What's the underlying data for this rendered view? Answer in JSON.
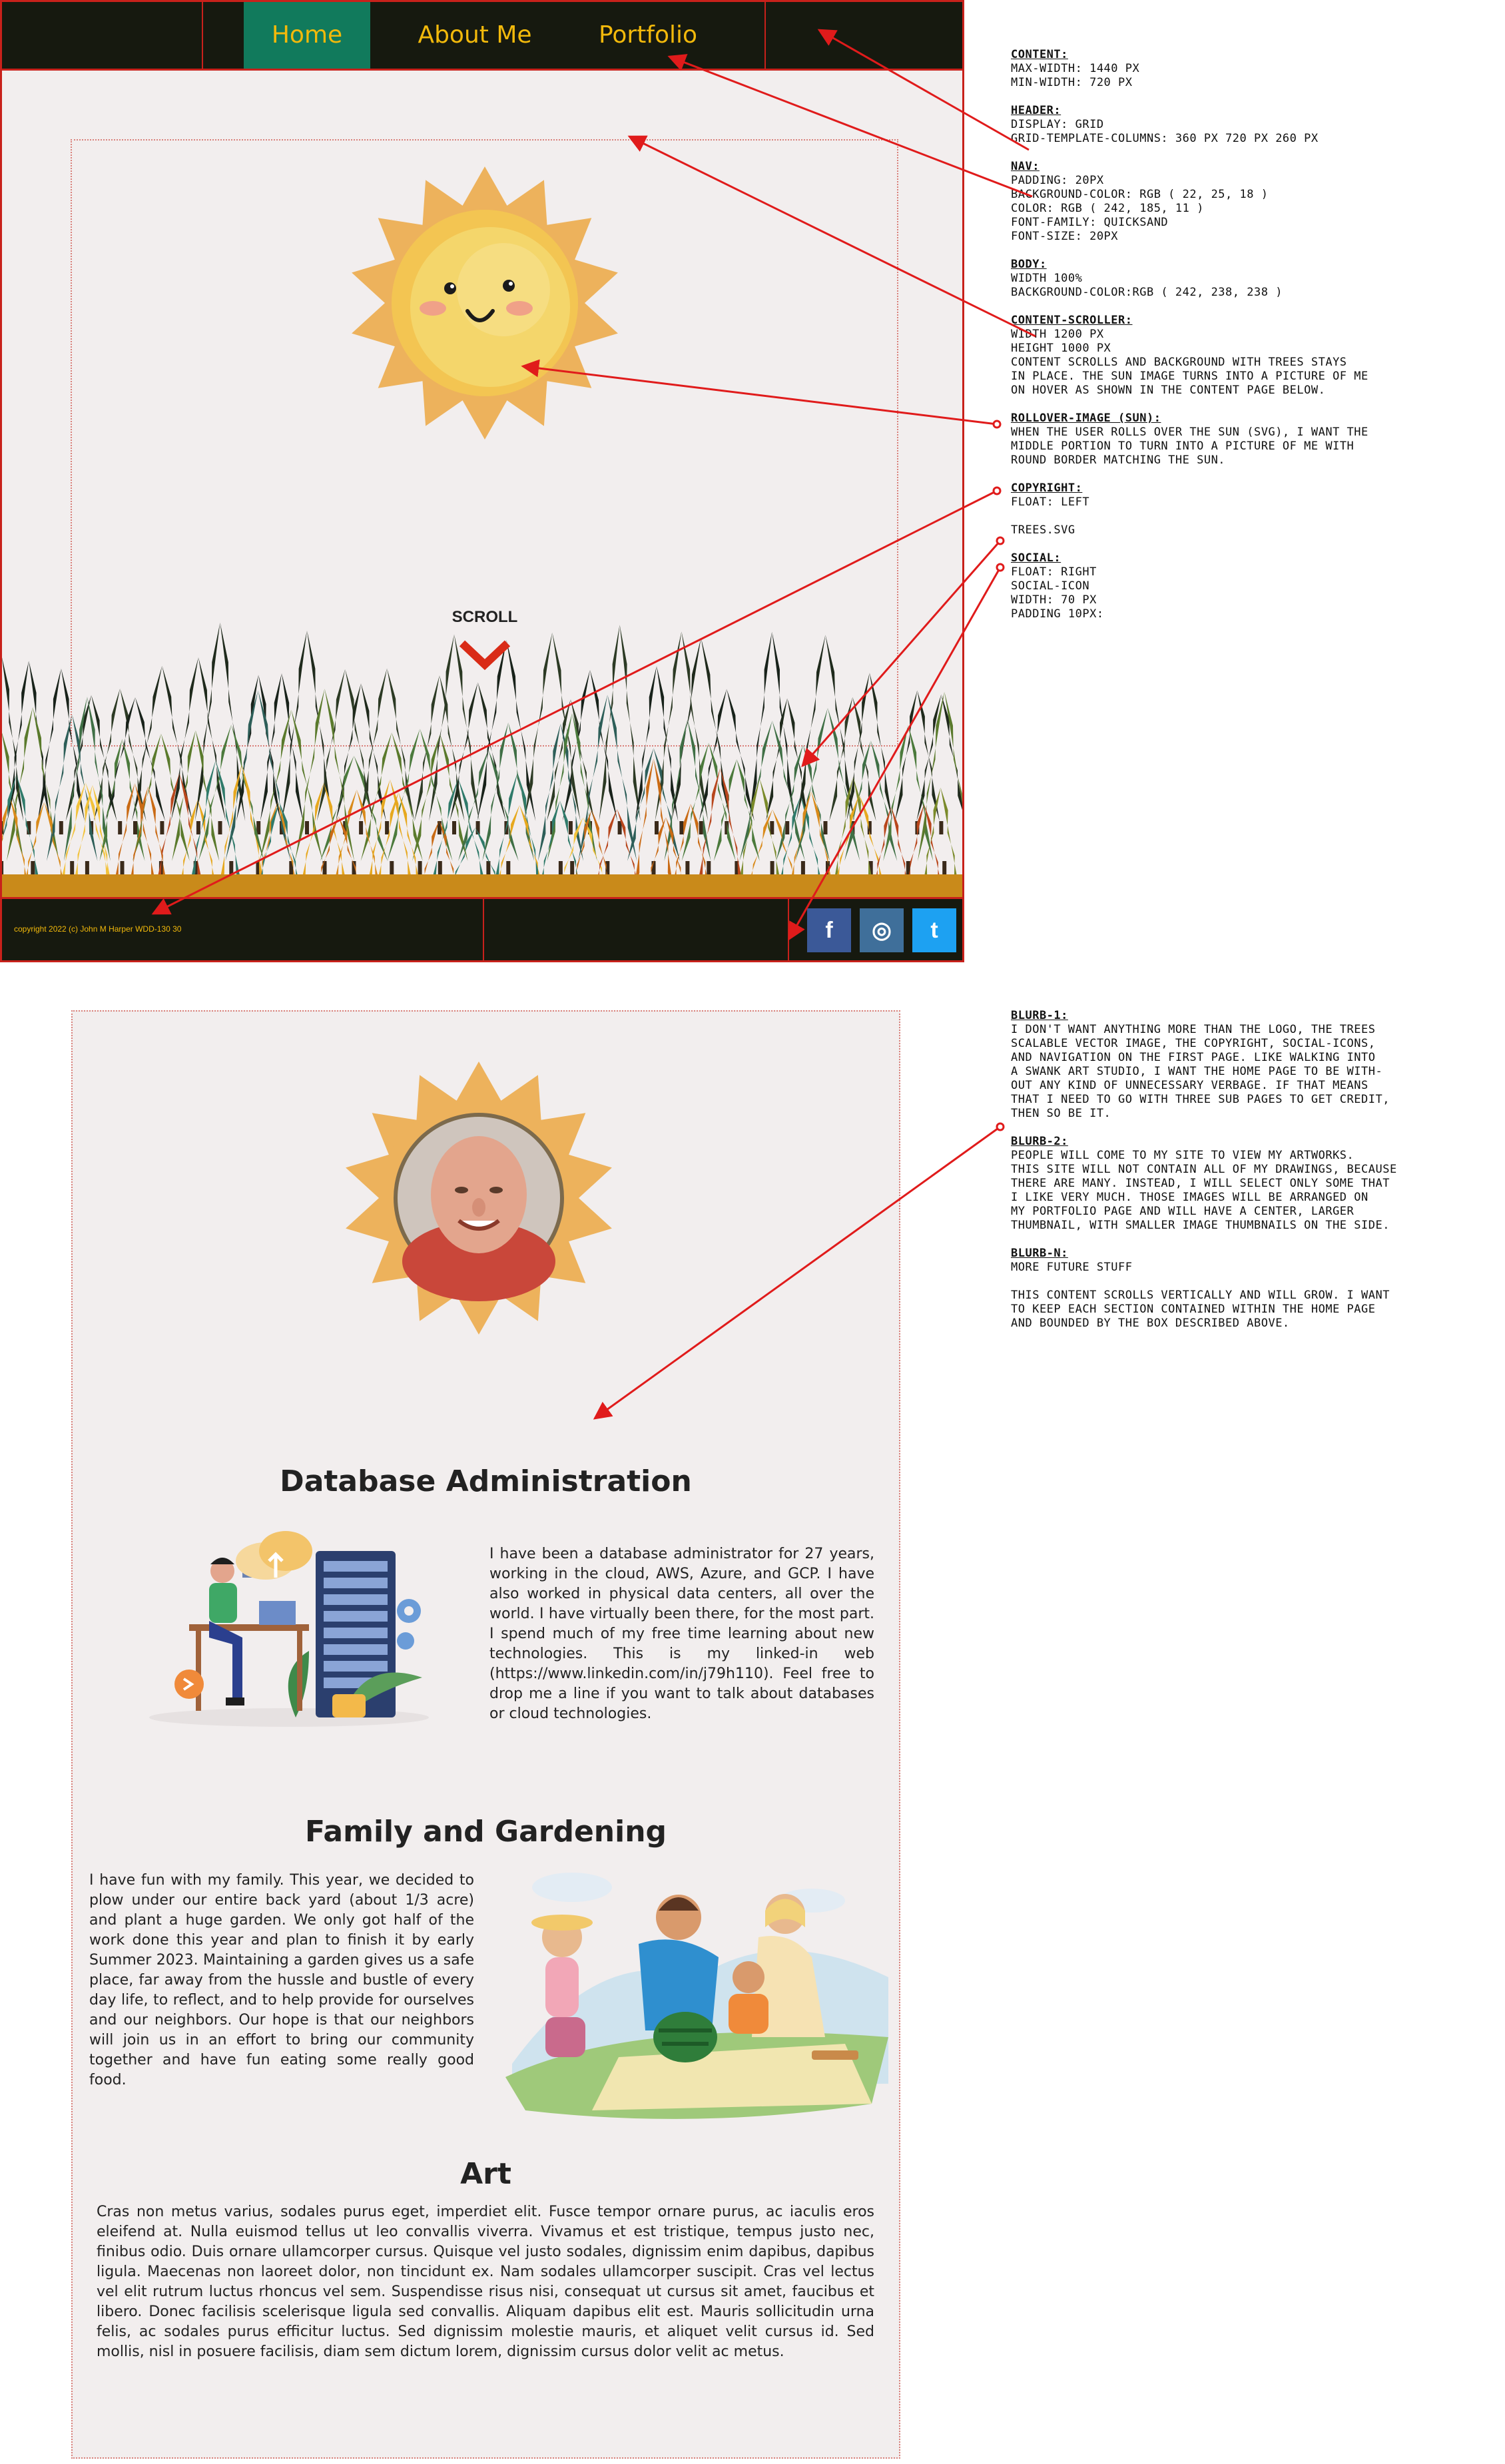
{
  "nav": {
    "items": [
      {
        "label": "Home"
      },
      {
        "label": "About Me"
      },
      {
        "label": "Portfolio"
      }
    ]
  },
  "hero": {
    "scroll_label": "SCROLL"
  },
  "footer": {
    "copyright": "copyright 2022 (c) John M Harper WDD-130 30",
    "social": [
      {
        "icon": "facebook-icon",
        "glyph": "f"
      },
      {
        "icon": "instagram-icon",
        "glyph": "◎"
      },
      {
        "icon": "twitter-icon",
        "glyph": "t"
      }
    ]
  },
  "notes_top": [
    {
      "title": "Content:",
      "lines": [
        "max-width: 1440 px",
        "min-width: 720 px"
      ]
    },
    {
      "title": "Header:",
      "lines": [
        "display: grid",
        "grid-template-columns: 360 px 720 px 260 px"
      ]
    },
    {
      "title": "Nav:",
      "lines": [
        "padding: 20px",
        "background-color: rgb ( 22, 25, 18 )",
        "color: rgb ( 242, 185, 11 )",
        "font-family: quicksand",
        "font-size: 20px"
      ]
    },
    {
      "title": "Body:",
      "lines": [
        "width 100%",
        "background-color:rgb ( 242, 238, 238 )"
      ]
    },
    {
      "title": "Content-scroller:",
      "lines": [
        "width 1200 px",
        "height 1000 px",
        "content scrolls and background with trees stays",
        "in place. the sun image turns into a picture of me",
        "on hover as shown in the content page below."
      ]
    },
    {
      "title": "rollover-image (sun):",
      "lines": [
        "when the user rolls over the sun (svg), I want the",
        "middle portion to turn into a picture of me with",
        "round border matching the sun."
      ]
    },
    {
      "title": "copyright:",
      "lines": [
        "float: left"
      ]
    },
    {
      "title": "",
      "lines": [
        "trees.svg"
      ]
    },
    {
      "title": "social:",
      "lines": [
        "float: right",
        "social-icon",
        "width: 70 px",
        "padding 10px:"
      ]
    }
  ],
  "notes_bottom": [
    {
      "title": "blurb-1:",
      "lines": [
        "I don't want anything more than the logo, the trees",
        "scalable vector image, the copyright, social-icons,",
        "and navigation on the first page. Like walking into",
        "a swank art studio, I want the home page to be with-",
        "out any kind of unnecessary verbage. If that means",
        "that I need to go with three sub pages to get credit,",
        "then so be it."
      ]
    },
    {
      "title": "blurb-2:",
      "lines": [
        "People will come to my site to view my artworks.",
        "This site will not contain all of my drawings, because",
        "there are many. Instead, I will select only some that",
        "I like very much. Those images will be arranged on",
        "my portfolio page and will have a center, larger",
        "thumbnail, with smaller image thumbnails on the side."
      ]
    },
    {
      "title": "blurb-n:",
      "lines": [
        "more future stuff"
      ]
    },
    {
      "title": "",
      "lines": [
        "This content scrolls vertically and will grow. I want",
        "to keep each section contained within the home page",
        "and bounded by the box described above."
      ]
    }
  ],
  "sections": {
    "db": {
      "title": "Database Administration",
      "text": "I have been a database administrator for 27 years, working in the cloud, AWS, Azure, and GCP. I have also worked in physical data centers, all over the world. I have virtually been there, for the most part. I spend much of my free time learning about new technologies. This is my linked-in web (https://www.linkedin.com/in/j79h110). Feel free to drop me a line if you want to talk about databases or cloud technologies."
    },
    "family": {
      "title": "Family and Gardening",
      "text": "I have fun with my family. This year, we decided to plow under our entire back yard (about 1/3 acre) and plant a huge garden. We only got half of the work done this year and plan to finish it by early Summer 2023. Maintaining a garden gives us a safe place, far away from the hussle and bustle of every day life, to reflect, and to help provide for ourselves and our neighbors. Our hope is that our neighbors will join us in an effort to bring our community together and have fun eating some really good food."
    },
    "art": {
      "title": "Art",
      "text": "Cras non metus varius, sodales purus eget, imperdiet elit. Fusce tempor ornare purus, ac iaculis eros eleifend at. Nulla euismod tellus ut leo convallis viverra. Vivamus et est tristique, tempus justo nec, finibus odio. Duis ornare ullamcorper cursus. Quisque vel justo sodales, dignissim enim dapibus, dapibus ligula. Maecenas non laoreet dolor, non tincidunt ex. Nam sodales ullamcorper suscipit. Cras vel lectus vel elit rutrum luctus rhoncus vel sem. Suspendisse risus nisi, consequat ut cursus sit amet, faucibus et libero. Donec facilisis scelerisque ligula sed convallis. Aliquam dapibus elit est. Mauris sollicitudin urna felis, ac sodales purus efficitur luctus. Sed dignissim molestie mauris, et aliquet velit cursus id. Sed mollis, nisl in posuere facilisis, diam sem dictum lorem, dignissim cursus dolor velit ac metus."
    }
  },
  "colors": {
    "nav_bg": "#16190f",
    "nav_text": "#f2b90b",
    "nav_active": "#117a5c",
    "body_bg": "#f2eeee",
    "annotation_red": "#e01b1b"
  }
}
